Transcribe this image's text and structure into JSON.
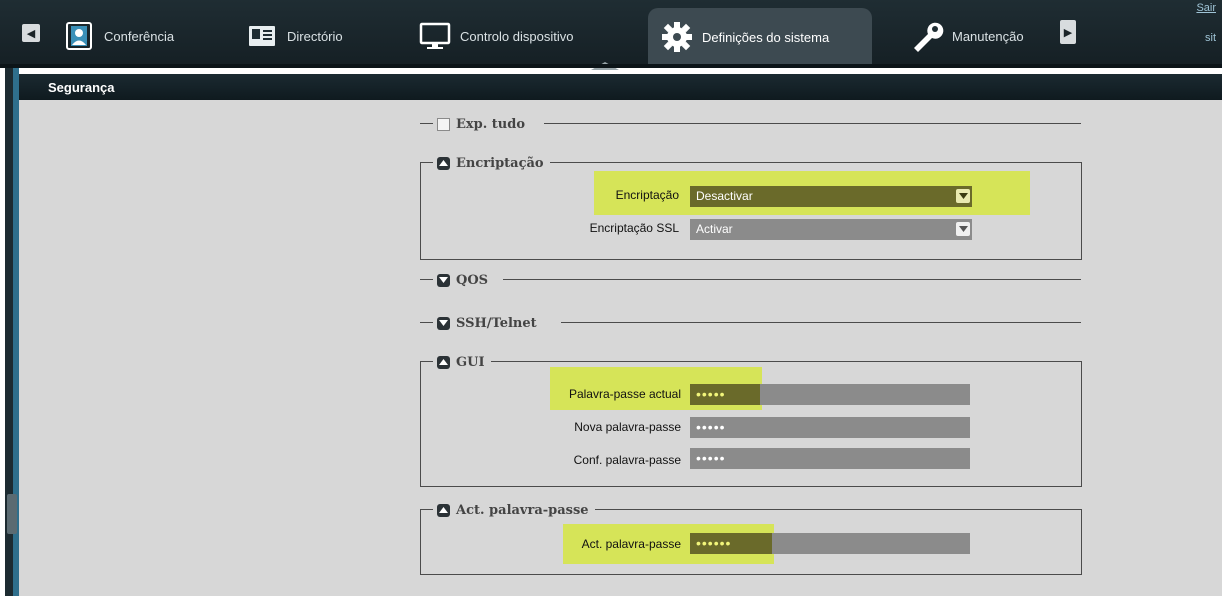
{
  "topbar": {
    "tabs": [
      {
        "label": "Conferência",
        "icon": "contact-card-icon"
      },
      {
        "label": "Directório",
        "icon": "address-book-icon"
      },
      {
        "label": "Controlo dispositivo",
        "icon": "monitor-icon"
      },
      {
        "label": "Definições do sistema",
        "icon": "gear-icon"
      },
      {
        "label": "Manutenção",
        "icon": "wrench-icon"
      }
    ],
    "sair": "Sair",
    "site_fragment": "sit"
  },
  "page_title": "Segurança",
  "exp_tudo": "Exp. tudo",
  "encriptacao": {
    "legend": "Encriptação",
    "encriptacao_label": "Encriptação",
    "encriptacao_value": "Desactivar",
    "ssl_label": "Encriptação SSL",
    "ssl_value": "Activar"
  },
  "qos": "QOS",
  "ssh": "SSH/Telnet",
  "gui": {
    "legend": "GUI",
    "current_label": "Palavra-passe actual",
    "current_value": "•••••",
    "new_label": "Nova palavra-passe",
    "new_value": "•••••",
    "conf_label": "Conf. palavra-passe",
    "conf_value": "•••••"
  },
  "act": {
    "legend": "Act. palavra-passe",
    "label": "Act. palavra-passe",
    "value": "••••••"
  },
  "colors": {
    "highlight": "#d6e82e",
    "field": "#8b8b8b",
    "panel": "#d7d7d7",
    "header": "#1b2a31"
  }
}
